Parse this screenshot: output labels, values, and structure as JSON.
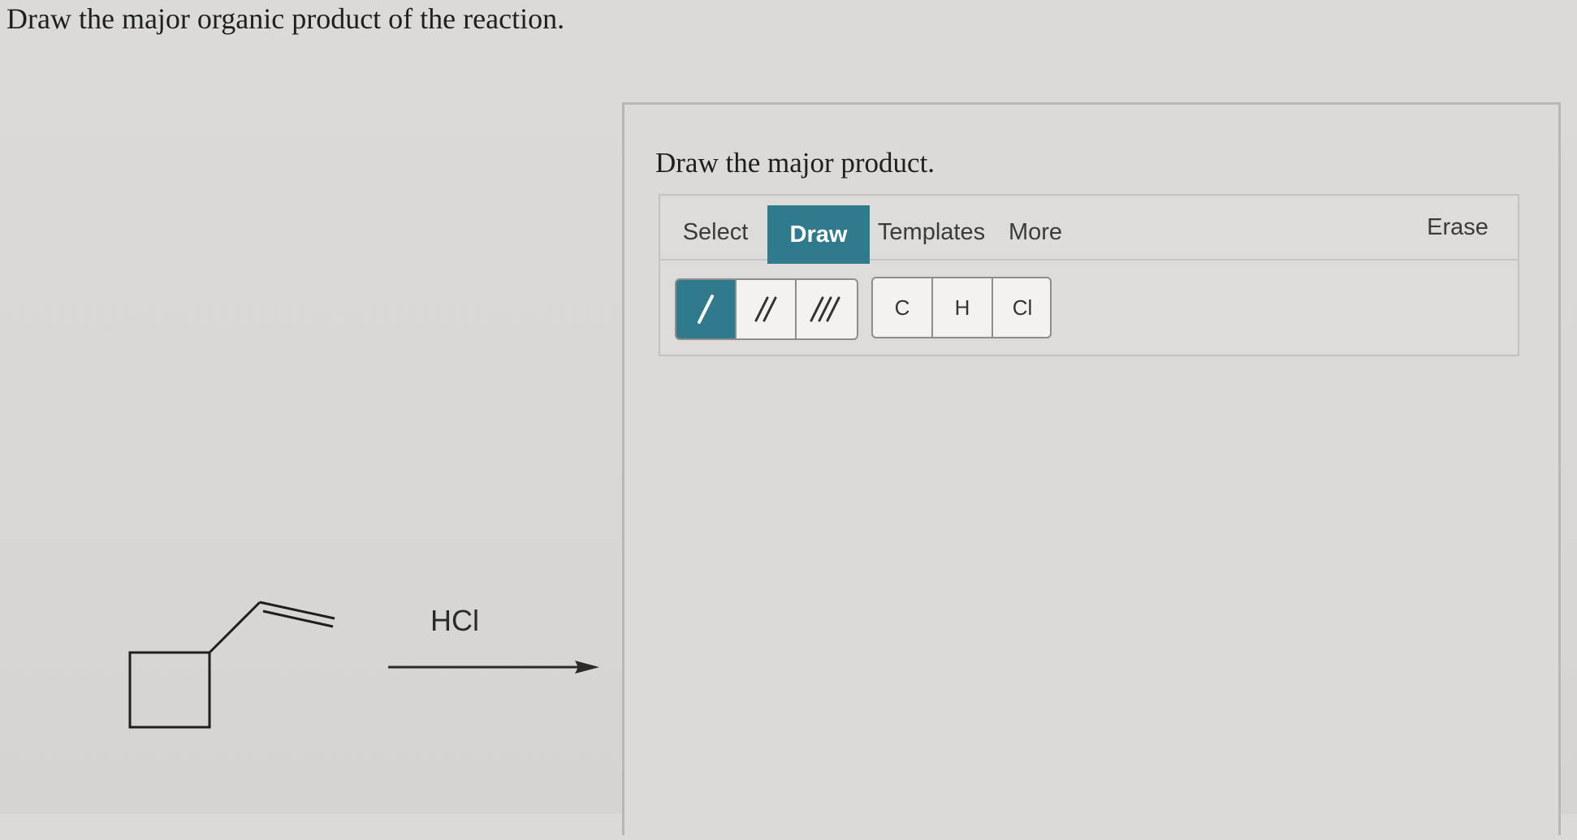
{
  "question": "Draw the major organic product of the reaction.",
  "reaction": {
    "reagent": "HCl",
    "reactant": "vinylcyclobutane"
  },
  "panel": {
    "prompt": "Draw the major product."
  },
  "editor": {
    "tabs": {
      "select": "Select",
      "draw": "Draw",
      "templates": "Templates",
      "more": "More",
      "erase": "Erase"
    },
    "active_tab": "Draw",
    "bond_tools": [
      "single-bond",
      "double-bond",
      "triple-bond"
    ],
    "active_bond": "single-bond",
    "atoms": [
      "C",
      "H",
      "Cl"
    ]
  },
  "colors": {
    "accent": "#2f7a8d",
    "background": "#dcdad6"
  }
}
